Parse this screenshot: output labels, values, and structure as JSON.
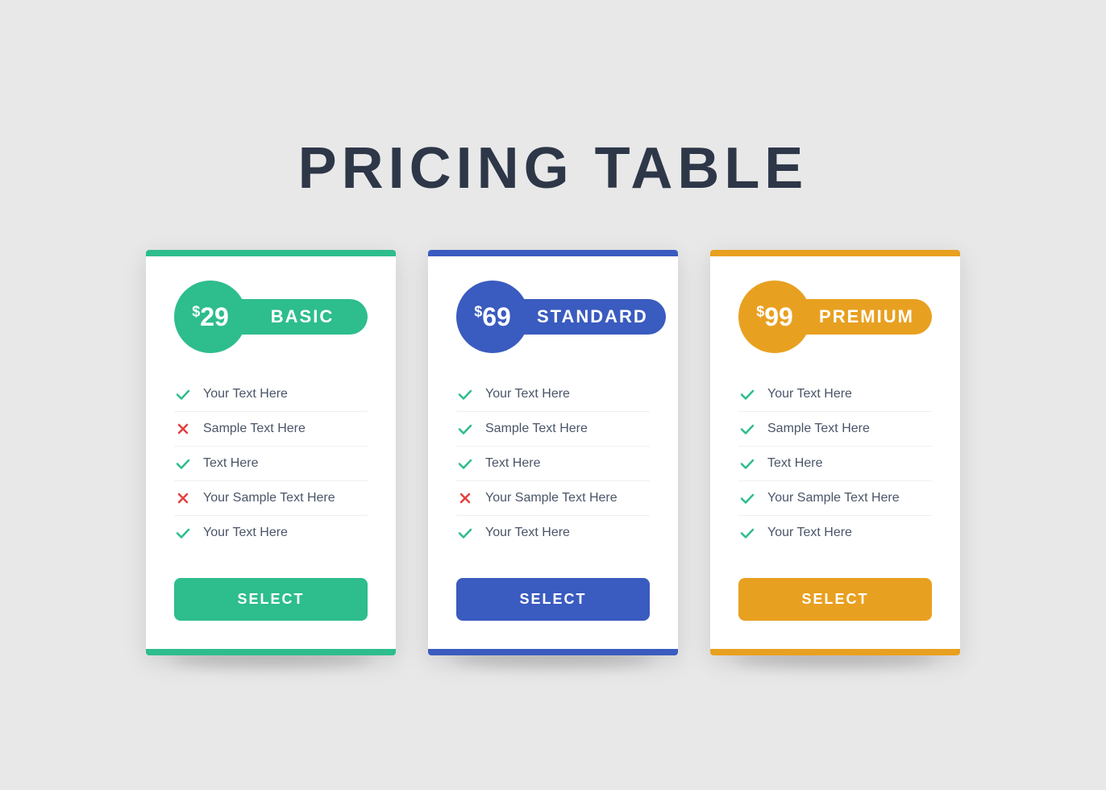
{
  "page": {
    "title": "PRICING TABLE",
    "background": "#e8e8e8"
  },
  "plans": [
    {
      "id": "basic",
      "price": "29",
      "currency": "$",
      "name": "BASIC",
      "color": "#2ebd8d",
      "features": [
        {
          "text": "Your Text Here",
          "included": true
        },
        {
          "text": "Sample Text Here",
          "included": false
        },
        {
          "text": "Text Here",
          "included": true
        },
        {
          "text": "Your Sample Text Here",
          "included": false
        },
        {
          "text": "Your Text Here",
          "included": true
        }
      ],
      "button_label": "SELECT"
    },
    {
      "id": "standard",
      "price": "69",
      "currency": "$",
      "name": "STANDARD",
      "color": "#3a5bbf",
      "features": [
        {
          "text": "Your Text Here",
          "included": true
        },
        {
          "text": "Sample Text Here",
          "included": true
        },
        {
          "text": "Text Here",
          "included": true
        },
        {
          "text": "Your Sample Text Here",
          "included": false
        },
        {
          "text": "Your Text Here",
          "included": true
        }
      ],
      "button_label": "SELECT"
    },
    {
      "id": "premium",
      "price": "99",
      "currency": "$",
      "name": "PREMIUM",
      "color": "#e8a020",
      "features": [
        {
          "text": "Your Text Here",
          "included": true
        },
        {
          "text": "Sample Text Here",
          "included": true
        },
        {
          "text": "Text Here",
          "included": true
        },
        {
          "text": "Your Sample Text Here",
          "included": true
        },
        {
          "text": "Your Text Here",
          "included": true
        }
      ],
      "button_label": "SELECT"
    }
  ]
}
